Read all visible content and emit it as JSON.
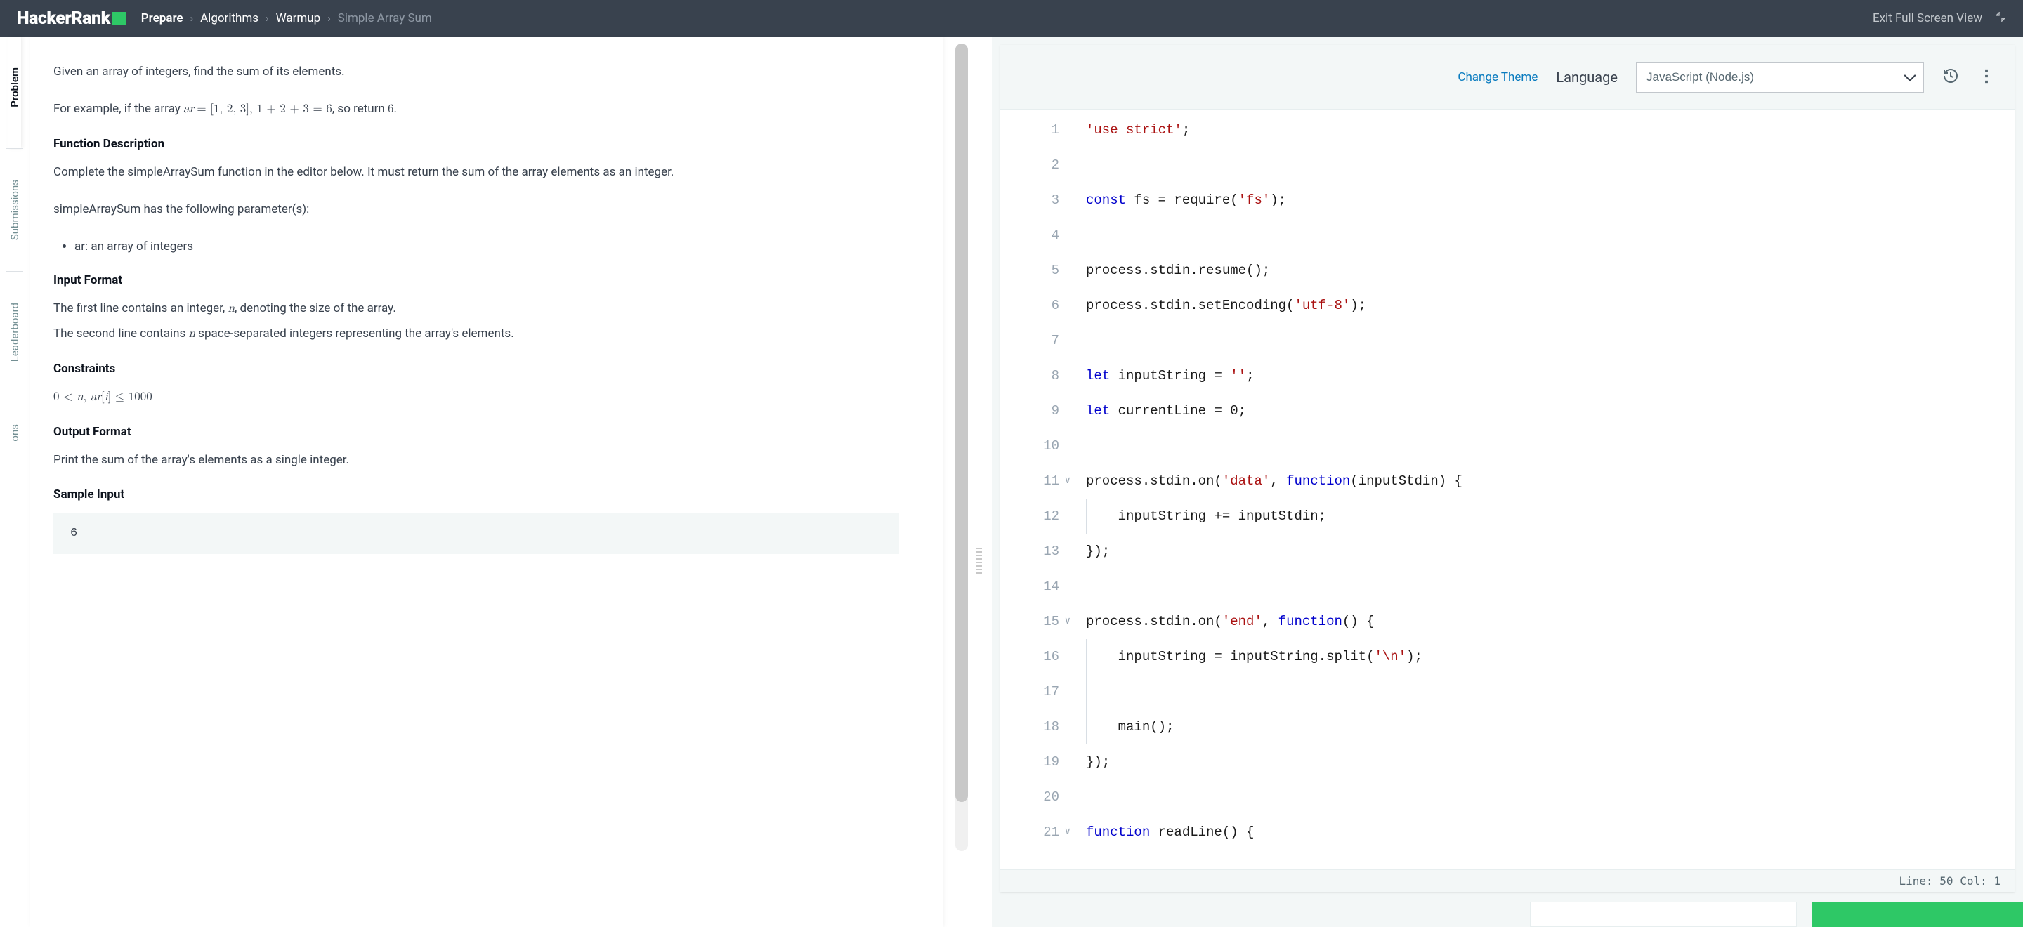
{
  "header": {
    "logo": "HackerRank",
    "breadcrumb": [
      "Prepare",
      "Algorithms",
      "Warmup",
      "Simple Array Sum"
    ],
    "exit": "Exit Full Screen View"
  },
  "tabs": [
    "Problem",
    "Submissions",
    "Leaderboard",
    "ons"
  ],
  "problem": {
    "p1": "Given an array of integers, find the sum of its elements.",
    "p2a": "For example, if the array ",
    "p2_math": "ar = [1, 2, 3], 1 + 2 + 3 = 6",
    "p2b": ", so return ",
    "p2c": "6",
    "p2d": ".",
    "h_fd": "Function Description",
    "p3": "Complete the simpleArraySum function in the editor below. It must return the sum of the array elements as an integer.",
    "p4": "simpleArraySum has the following parameter(s):",
    "li1": "ar: an array of integers",
    "h_if": "Input Format",
    "p5a": "The first line contains an integer, ",
    "p5b": ", denoting the size of the array.",
    "p6a": "The second line contains ",
    "p6b": " space-separated integers representing the array's elements.",
    "h_c": "Constraints",
    "constraint": "0 < n, ar[i] ≤ 1000",
    "h_of": "Output Format",
    "p7": "Print the sum of the array's elements as a single integer.",
    "h_si": "Sample Input",
    "sample": "6"
  },
  "editor": {
    "theme": "Change Theme",
    "lang_label": "Language",
    "lang_value": "JavaScript (Node.js)",
    "status": "Line: 50 Col: 1"
  },
  "code": {
    "l1a": "'use strict'",
    "l1b": ";",
    "l3a": "const",
    "l3b": " fs = require(",
    "l3c": "'fs'",
    "l3d": ");",
    "l5": "process.stdin.resume();",
    "l6a": "process.stdin.setEncoding(",
    "l6b": "'utf-8'",
    "l6c": ");",
    "l8a": "let",
    "l8b": " inputString = ",
    "l8c": "''",
    "l8d": ";",
    "l9a": "let",
    "l9b": " currentLine = 0;",
    "l11a": "process.stdin.on(",
    "l11b": "'data'",
    "l11c": ", ",
    "l11d": "function",
    "l11e": "(inputStdin) {",
    "l12": "    inputString += inputStdin;",
    "l13": "});",
    "l15a": "process.stdin.on(",
    "l15b": "'end'",
    "l15c": ", ",
    "l15d": "function",
    "l15e": "() {",
    "l16a": "    inputString = inputString.split(",
    "l16b": "'\\n'",
    "l16c": ");",
    "l18": "    main();",
    "l19": "});",
    "l21a": "function",
    "l21b": " readLine() {"
  },
  "linenums": [
    "1",
    "2",
    "3",
    "4",
    "5",
    "6",
    "7",
    "8",
    "9",
    "10",
    "11",
    "12",
    "13",
    "14",
    "15",
    "16",
    "17",
    "18",
    "19",
    "20",
    "21"
  ]
}
